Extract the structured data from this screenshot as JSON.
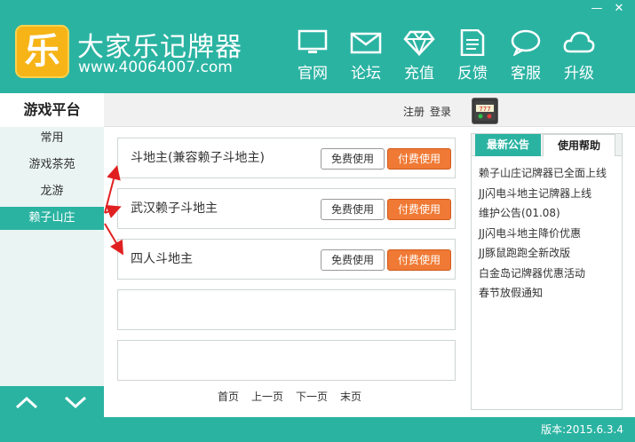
{
  "app": {
    "logo_char": "乐",
    "title": "大家乐记牌器",
    "url": "www.40064007.com"
  },
  "window_controls": {
    "minimize": "—",
    "close": "✕"
  },
  "nav": [
    {
      "label": "官网",
      "icon": "monitor-icon"
    },
    {
      "label": "论坛",
      "icon": "envelope-icon"
    },
    {
      "label": "充值",
      "icon": "diamond-icon"
    },
    {
      "label": "反馈",
      "icon": "document-icon"
    },
    {
      "label": "客服",
      "icon": "chat-bubble-icon"
    },
    {
      "label": "升级",
      "icon": "cloud-icon"
    }
  ],
  "sidebar": {
    "title": "游戏平台",
    "items": [
      {
        "label": "常用"
      },
      {
        "label": "游戏茶苑"
      },
      {
        "label": "龙游"
      },
      {
        "label": "赖子山庄",
        "active": true
      }
    ]
  },
  "topbar": {
    "register": "注册",
    "login": "登录"
  },
  "games": [
    {
      "name": "斗地主(兼容赖子斗地主)",
      "free": "免费使用",
      "paid": "付费使用"
    },
    {
      "name": "武汉赖子斗地主",
      "free": "免费使用",
      "paid": "付费使用"
    },
    {
      "name": "四人斗地主",
      "free": "免费使用",
      "paid": "付费使用"
    }
  ],
  "pager": {
    "first": "首页",
    "prev": "上一页",
    "next": "下一页",
    "last": "末页"
  },
  "right_panel": {
    "tab_news": "最新公告",
    "tab_help": "使用帮助",
    "news": [
      "赖子山庄记牌器已全面上线",
      "JJ闪电斗地主记牌器上线",
      "维护公告(01.08)",
      "JJ闪电斗地主降价优惠",
      "JJ豚鼠跑跑全新改版",
      "白金岛记牌器优惠活动",
      "春节放假通知"
    ]
  },
  "status": {
    "version": "版本:2015.6.3.4"
  },
  "colors": {
    "teal": "#2bb3a2",
    "orange": "#f07a35",
    "logo_yellow": "#f6b417",
    "annotation_red": "#e02020"
  }
}
